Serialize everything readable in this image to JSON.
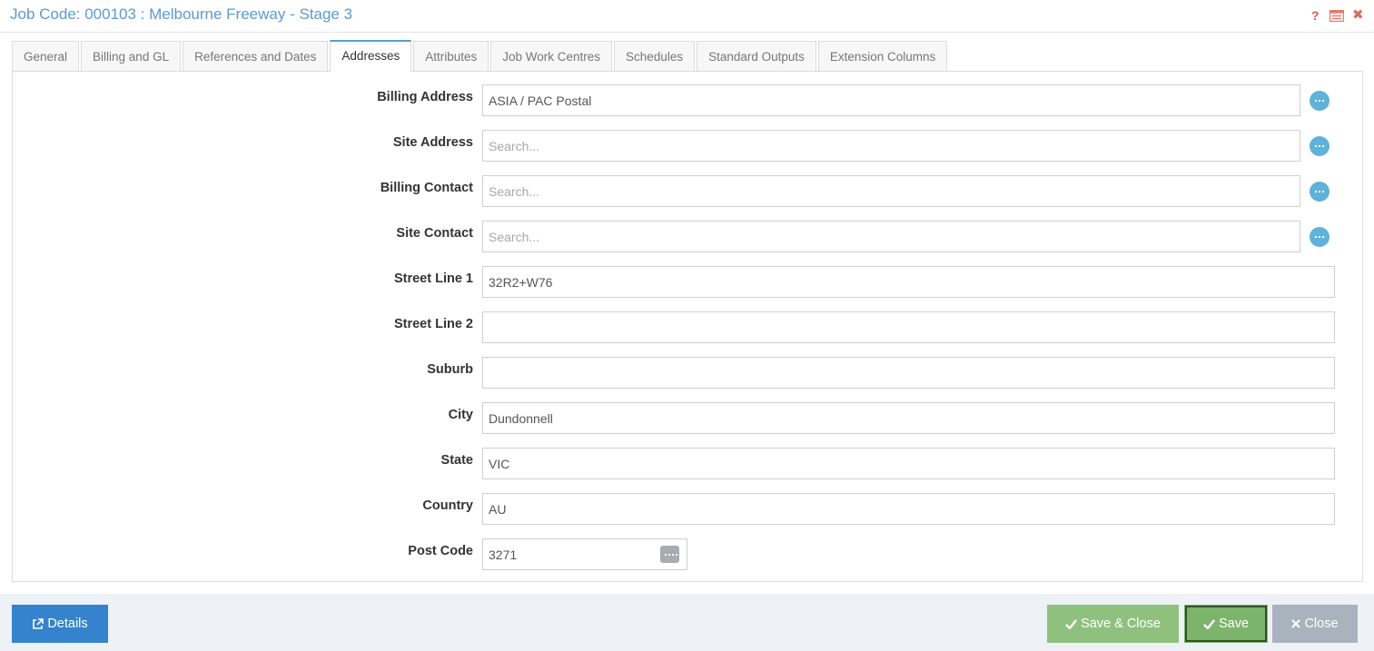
{
  "window": {
    "title": "Job Code: 000103 : Melbourne Freeway - Stage 3",
    "help_glyph": "?",
    "close_glyph": "✖"
  },
  "tabs": [
    {
      "label": "General"
    },
    {
      "label": "Billing and GL"
    },
    {
      "label": "References and Dates"
    },
    {
      "label": "Addresses"
    },
    {
      "label": "Attributes"
    },
    {
      "label": "Job Work Centres"
    },
    {
      "label": "Schedules"
    },
    {
      "label": "Standard Outputs"
    },
    {
      "label": "Extension Columns"
    }
  ],
  "active_tab": "Addresses",
  "form": {
    "billing_address": {
      "label": "Billing Address",
      "value": "ASIA / PAC Postal",
      "placeholder": "Search..."
    },
    "site_address": {
      "label": "Site Address",
      "value": "",
      "placeholder": "Search..."
    },
    "billing_contact": {
      "label": "Billing Contact",
      "value": "",
      "placeholder": "Search..."
    },
    "site_contact": {
      "label": "Site Contact",
      "value": "",
      "placeholder": "Search..."
    },
    "street_line_1": {
      "label": "Street Line 1",
      "value": "32R2+W76"
    },
    "street_line_2": {
      "label": "Street Line 2",
      "value": ""
    },
    "suburb": {
      "label": "Suburb",
      "value": ""
    },
    "city": {
      "label": "City",
      "value": "Dundonnell"
    },
    "state": {
      "label": "State",
      "value": "VIC"
    },
    "country": {
      "label": "Country",
      "value": "AU"
    },
    "post_code": {
      "label": "Post Code",
      "value": "3271"
    }
  },
  "footer": {
    "details_label": "Details",
    "save_close_label": "Save & Close",
    "save_label": "Save",
    "close_label": "Close"
  },
  "icons": {
    "help": "question-icon",
    "minimize": "window-icon",
    "close": "close-icon",
    "more": "ellipsis-icon",
    "external": "external-link-icon",
    "check": "check-icon",
    "x": "x-icon"
  },
  "colors": {
    "accent": "#5b9bd1",
    "more_button": "#5fb2d9",
    "details_button": "#3583cc",
    "save_close_button": "#8fc17e",
    "save_button": "#7db46c",
    "close_button": "#a9b3bd",
    "footer_bg": "#eef1f6"
  }
}
